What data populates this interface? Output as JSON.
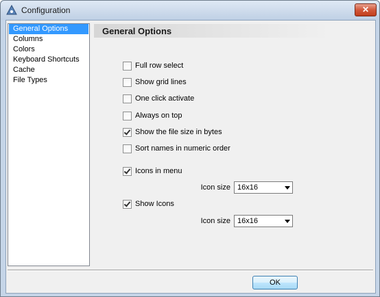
{
  "window": {
    "title": "Configuration",
    "close_label": "✕"
  },
  "sidebar": {
    "items": [
      {
        "label": "General Options",
        "selected": true
      },
      {
        "label": "Columns"
      },
      {
        "label": "Colors"
      },
      {
        "label": "Keyboard Shortcuts"
      },
      {
        "label": "Cache"
      },
      {
        "label": "File Types"
      }
    ]
  },
  "panel": {
    "title": "General Options",
    "options": [
      {
        "label": "Full row select",
        "checked": false
      },
      {
        "label": "Show grid lines",
        "checked": false
      },
      {
        "label": "One click activate",
        "checked": false
      },
      {
        "label": "Always on top",
        "checked": false
      },
      {
        "label": "Show the file size in bytes",
        "checked": true
      },
      {
        "label": "Sort names in numeric order",
        "checked": false
      },
      {
        "label": "Icons in menu",
        "checked": true
      },
      {
        "label": "Show Icons",
        "checked": true
      }
    ],
    "menu_icon_size": {
      "label": "Icon size",
      "value": "16x16"
    },
    "show_icon_size": {
      "label": "Icon size",
      "value": "16x16"
    }
  },
  "footer": {
    "ok_label": "OK"
  },
  "colors": {
    "selection": "#3399ff",
    "titlebar": "#cfdcec",
    "close_button": "#c13d1c"
  }
}
